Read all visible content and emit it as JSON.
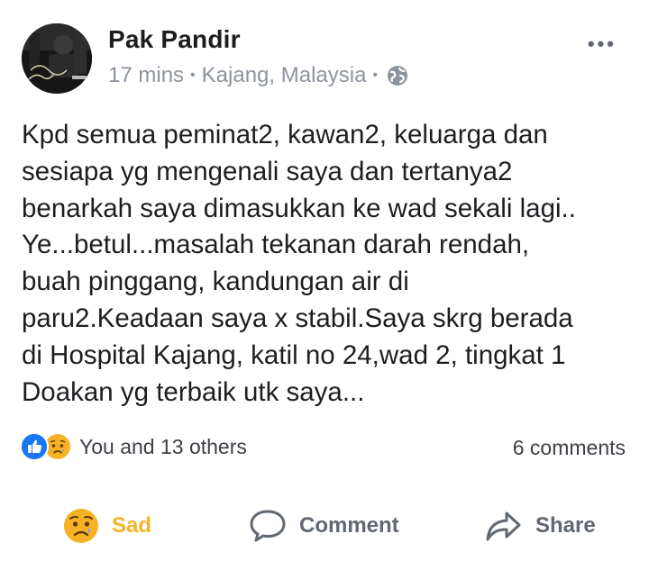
{
  "post": {
    "author": "Pak Pandir",
    "time": "17 mins",
    "separator": "•",
    "location": "Kajang, Malaysia",
    "privacy_icon": "globe-icon",
    "menu_icon": "more-options-icon",
    "menu_label": "•••",
    "avatar_text": "Pak Pandir",
    "body_lines": [
      "Kpd semua peminat2, kawan2, keluarga dan",
      "sesiapa yg mengenali saya dan tertanya2",
      "benarkah saya dimasukkan ke wad sekali lagi..",
      "Ye...betul...masalah tekanan darah rendah,",
      "buah pinggang, kandungan air di",
      "paru2.Keadaan saya x stabil.Saya skrg berada",
      "di Hospital Kajang, katil no 24,wad 2, tingkat 1",
      "Doakan yg terbaik utk saya..."
    ]
  },
  "reactions": {
    "icons": [
      "like-icon",
      "sad-emoji-icon"
    ],
    "summary": "You and 13 others",
    "comments": "6 comments"
  },
  "actions": {
    "react_label": "Sad",
    "react_icon": "sad-emoji-icon",
    "comment_label": "Comment",
    "comment_icon": "comment-icon",
    "share_label": "Share",
    "share_icon": "share-icon"
  },
  "colors": {
    "sad_accent": "#f7b125",
    "like_blue": "#1877f2",
    "meta_gray": "#8d949e",
    "action_gray": "#606770"
  }
}
